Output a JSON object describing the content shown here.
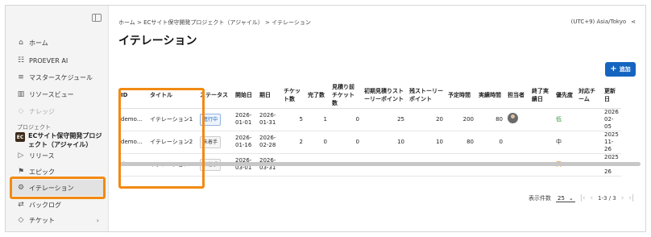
{
  "sidebar": {
    "items": [
      {
        "label": "ホーム",
        "icon": "home-icon"
      },
      {
        "label": "PROEVER AI",
        "icon": "ai-icon"
      },
      {
        "label": "マスタースケジュール",
        "icon": "schedule-icon"
      },
      {
        "label": "リソースビュー",
        "icon": "chart-icon"
      },
      {
        "label": "ナレッジ",
        "icon": "knowledge-icon",
        "disabled": true
      }
    ],
    "project_label": "プロジェクト",
    "project_badge": "EC",
    "project_name": "ECサイト保守開発プロジェクト（アジャイル）",
    "project_items": [
      {
        "label": "リリース",
        "icon": "release-icon"
      },
      {
        "label": "エピック",
        "icon": "epic-icon"
      },
      {
        "label": "イテレーション",
        "icon": "iteration-icon",
        "active": true
      },
      {
        "label": "バックログ",
        "icon": "backlog-icon"
      },
      {
        "label": "チケット",
        "icon": "ticket-icon",
        "chevron": "›"
      }
    ]
  },
  "header": {
    "breadcrumb": "ホーム > ECサイト保守開発プロジェクト（アジャイル） > イテレーション",
    "timezone": "(UTC+9) Asia/Tokyo",
    "share_icon": "share-icon",
    "title": "イテレーション",
    "add_button": "追加"
  },
  "table": {
    "columns": [
      "ID",
      "タイトル",
      "ステータス",
      "開始日",
      "期日",
      "チケット数",
      "完了数",
      "見積り前チケット数",
      "初期見積りストーリーポイント",
      "残ストーリーポイント",
      "予定時間",
      "実績時間",
      "担当者",
      "終了実績日",
      "優先度",
      "対応チーム",
      "更新日"
    ],
    "rows": [
      {
        "id": "demo…",
        "title": "イテレーション1",
        "status": "進行中",
        "start": "2026-01-01",
        "due": "2026-01-31",
        "tickets": "5",
        "done": "1",
        "unestimated": "0",
        "initial_sp": "25",
        "remaining_sp": "20",
        "planned": "200",
        "actual": "80",
        "assignee": "avatar",
        "end_actual": "",
        "priority": "低",
        "team": "",
        "updated": "2026 02-05"
      },
      {
        "id": "demo…",
        "title": "イテレーション2",
        "status": "未着手",
        "start": "2026-01-16",
        "due": "2026-02-28",
        "tickets": "2",
        "done": "0",
        "unestimated": "0",
        "initial_sp": "10",
        "remaining_sp": "10",
        "planned": "80",
        "actual": "0",
        "assignee": "",
        "end_actual": "",
        "priority": "中",
        "team": "",
        "updated": "2025 11-26"
      },
      {
        "id": "demo…",
        "title": "イテレーション3",
        "status": "未着手",
        "start": "2026-03-01",
        "due": "2026-03-31",
        "tickets": "0",
        "done": "0",
        "unestimated": "0",
        "initial_sp": "0",
        "remaining_sp": "0",
        "planned": "0",
        "actual": "0",
        "assignee": "",
        "end_actual": "",
        "priority": "高",
        "team": "",
        "updated": "2025 11-26"
      }
    ]
  },
  "pager": {
    "label": "表示件数",
    "per_page": "25",
    "range": "1-3 / 3"
  },
  "colors": {
    "accent": "#1565c0",
    "highlight": "#f28a12"
  }
}
